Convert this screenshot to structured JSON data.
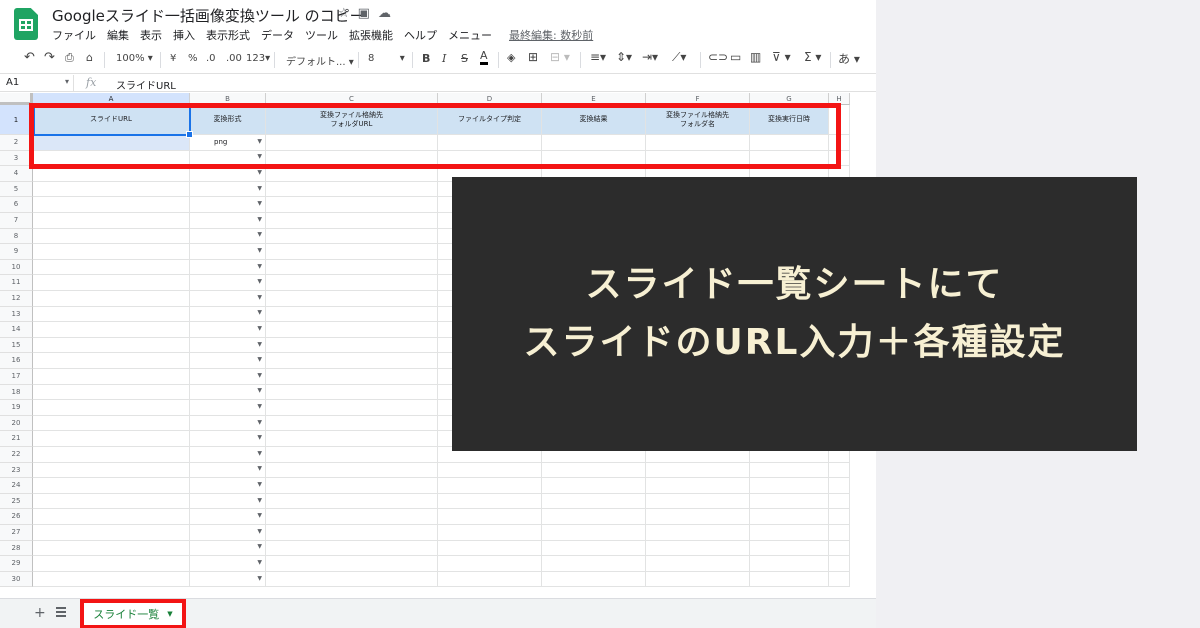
{
  "app": {
    "doc_title": "Googleスライド一括画像変換ツール のコピー",
    "title_icons": [
      "star-icon",
      "move-folder-icon",
      "cloud-status-icon"
    ],
    "menu": [
      "ファイル",
      "編集",
      "表示",
      "挿入",
      "表示形式",
      "データ",
      "ツール",
      "拡張機能",
      "ヘルプ",
      "メニュー"
    ],
    "last_edit": "最終編集: 数秒前"
  },
  "toolbar": {
    "zoom": "100%",
    "currency": "¥",
    "percent": "%",
    "dec_decrease": ".0",
    "dec_increase": ".00",
    "more_formats": "123",
    "font": "デフォルト...",
    "font_size": "8",
    "bold": "B",
    "italic": "I",
    "strike": "S",
    "text_color": "A",
    "sum": "Σ",
    "input_tool": "あ"
  },
  "formula_bar": {
    "cell_ref": "A1",
    "fx": "fx",
    "content": "スライドURL"
  },
  "grid": {
    "columns": [
      "A",
      "B",
      "C",
      "D",
      "E",
      "F",
      "G",
      "H"
    ],
    "header_row": [
      "スライドURL",
      "変換形式",
      "変換ファイル格納先\nフォルダURL",
      "ファイルタイプ判定",
      "変換結果",
      "変換ファイル格納先\nフォルダ名",
      "変換実行日時"
    ],
    "row2_b": "png",
    "row_count": 30
  },
  "sheet_tab": {
    "add": "+",
    "name": "スライド一覧"
  },
  "callout": {
    "line1": "スライド一覧シートにて",
    "line2": "スライドのURL入力＋各種設定"
  },
  "colors": {
    "header_fill": "#cfe2f3",
    "highlight_red": "#f31414",
    "callout_bg": "#2c2c2c",
    "callout_text": "#f7f0d3",
    "sheets_green": "#1fa463"
  }
}
